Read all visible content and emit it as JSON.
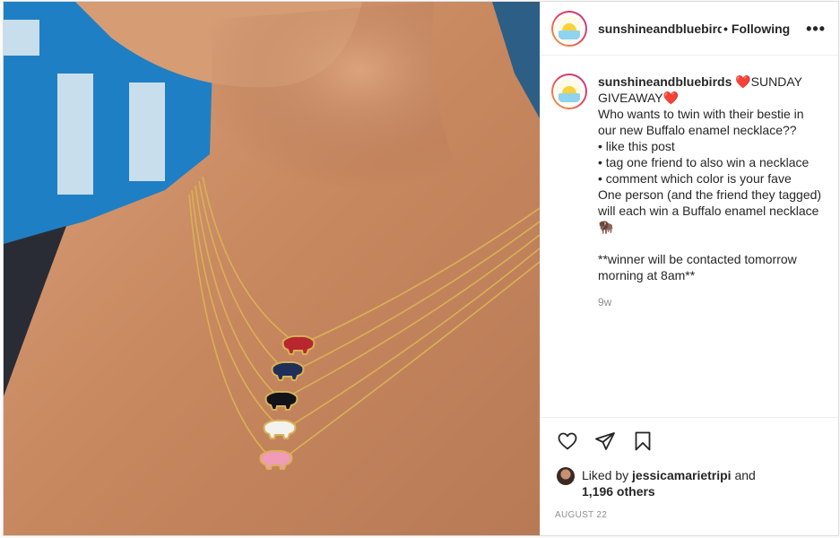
{
  "post": {
    "username": "sunshineandbluebirds",
    "follow_dot": "•",
    "follow_label": "Following",
    "more_label": "•••",
    "caption_user": "sunshineandbluebirds",
    "caption_text": " ❤️SUNDAY GIVEAWAY❤️\nWho wants to twin with their bestie in our new Buffalo enamel necklace??\n• like this post\n• tag one friend to also win a necklace\n• comment which color is your fave\nOne person (and the friend they tagged) will each win a Buffalo enamel necklace 🦬\n\n**winner will be contacted tomorrow morning at 8am**",
    "age": "9w",
    "liked_by_prefix": "Liked by ",
    "liked_by_user": "jessicamarietripi",
    "liked_by_and": " and",
    "others_count": "1,196 others",
    "date": "AUGUST 22"
  },
  "photo": {
    "pendant_colors": [
      "#b8262e",
      "#1f2f5a",
      "#111318",
      "#f4f2ee",
      "#f09bb8"
    ],
    "background_sign": "#1f7fc4",
    "skin": "#c98f68"
  },
  "icons": {
    "like": "heart-icon",
    "share": "send-icon",
    "save": "bookmark-icon"
  }
}
